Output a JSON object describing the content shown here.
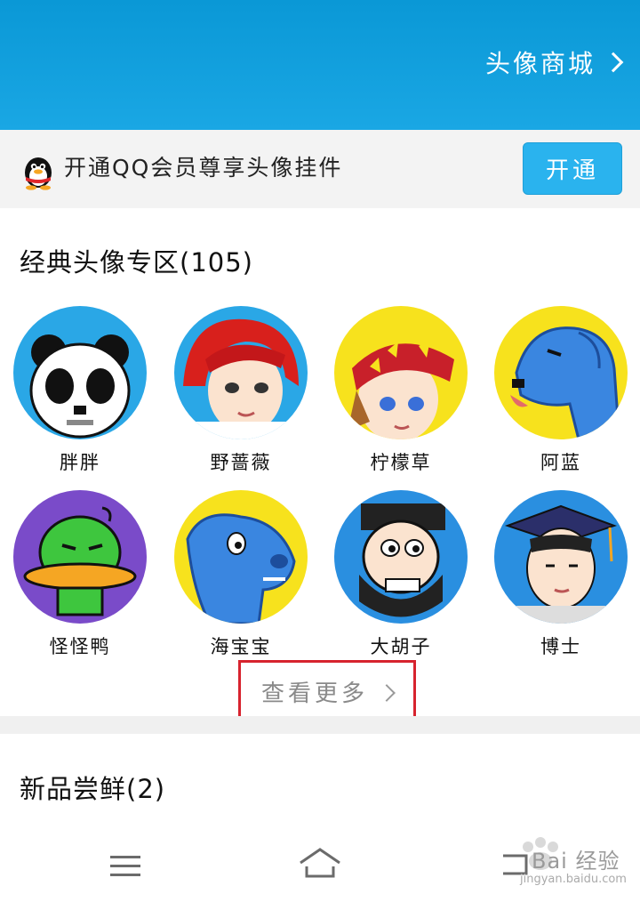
{
  "header": {
    "shop_link": "头像商城"
  },
  "vip_bar": {
    "text": "开通QQ会员尊享头像挂件",
    "button": "开通"
  },
  "classic_section": {
    "title": "经典头像专区(105)",
    "avatars": [
      {
        "name": "胖胖",
        "bg": "#2aa7e6"
      },
      {
        "name": "野蔷薇",
        "bg": "#2aa7e6"
      },
      {
        "name": "柠檬草",
        "bg": "#f7e21d"
      },
      {
        "name": "阿蓝",
        "bg": "#f7e21d"
      },
      {
        "name": "怪怪鸭",
        "bg": "#7a4bc9"
      },
      {
        "name": "海宝宝",
        "bg": "#f7e21d"
      },
      {
        "name": "大胡子",
        "bg": "#2a8fe0"
      },
      {
        "name": "博士",
        "bg": "#2a8fe0"
      }
    ],
    "more_label": "查看更多"
  },
  "new_section": {
    "title": "新品尝鲜(2)"
  },
  "watermark": {
    "text": "Bai 经验",
    "url": "jingyan.baidu.com"
  },
  "nav": {
    "icons": [
      "menu-icon",
      "home-icon",
      "back-icon"
    ]
  },
  "colors": {
    "header": "#1aa7e4",
    "button": "#2ab3ee",
    "highlight": "#d7232e"
  }
}
